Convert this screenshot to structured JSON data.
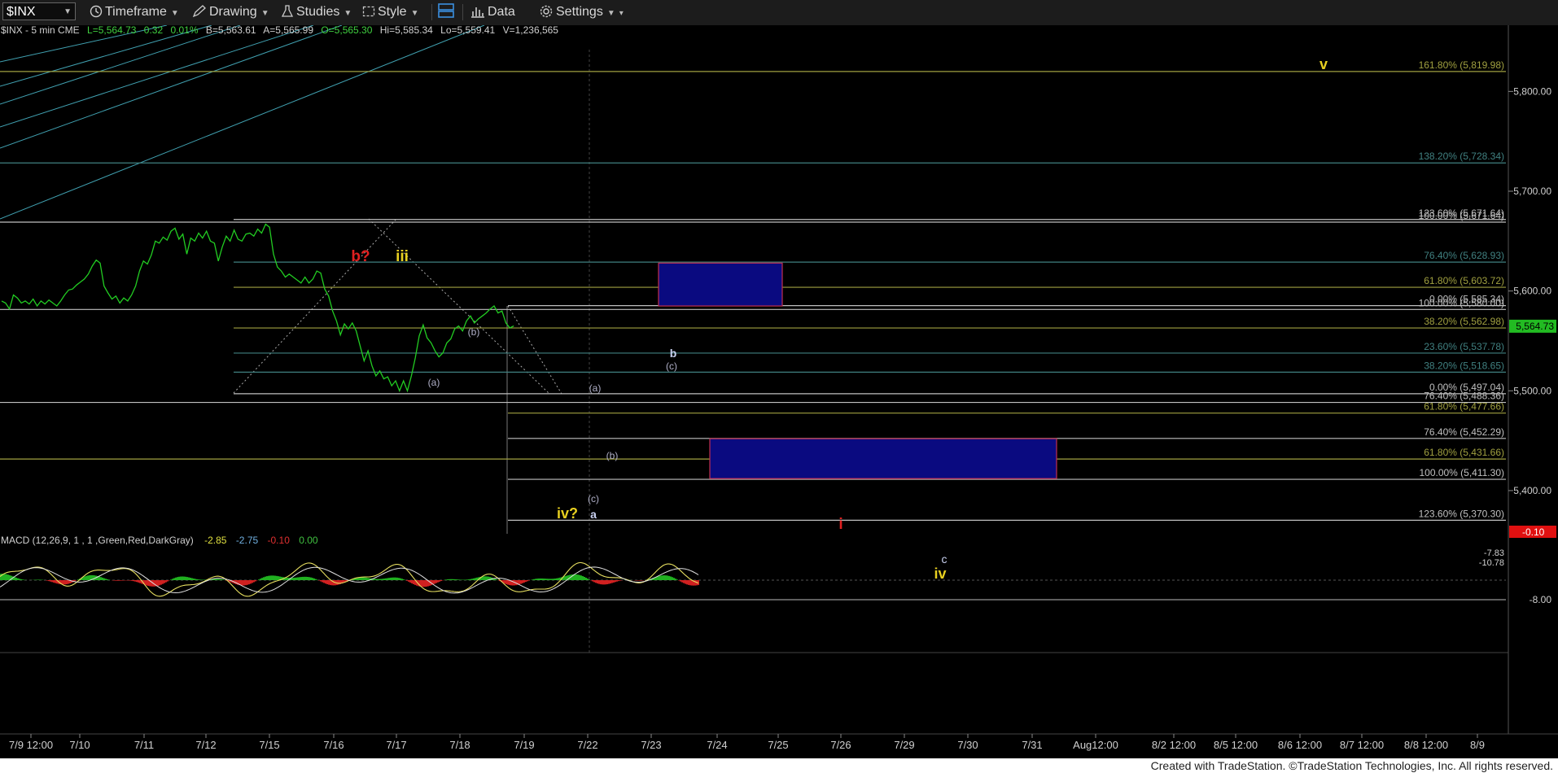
{
  "toolbar": {
    "symbol": "$INX",
    "timeframe": "Timeframe",
    "drawing": "Drawing",
    "studies": "Studies",
    "style": "Style",
    "data": "Data",
    "settings": "Settings"
  },
  "chart_data": {
    "type": "line",
    "info_line": "$INX - 5 min  CME",
    "quote": {
      "last": "L=5,564.73",
      "change": "0.32",
      "change_pct": "0.01%",
      "bid": "B=5,563.61",
      "ask": "A=5,565.99",
      "open": "O=5,565.30",
      "high": "Hi=5,585.34",
      "low": "Lo=5,559.41",
      "volume": "V=1,236,565"
    },
    "price_axis": {
      "ticks": [
        {
          "value": 5800,
          "label": "5,800.00"
        },
        {
          "value": 5700,
          "label": "5,700.00"
        },
        {
          "value": 5600,
          "label": "5,600.00"
        },
        {
          "value": 5500,
          "label": "5,500.00"
        },
        {
          "value": 5400,
          "label": "5,400.00"
        }
      ],
      "last_label": "5,564.73",
      "last_value": 5564.73
    },
    "x_labels": [
      "7/9 12:00",
      "7/10",
      "7/11",
      "7/12",
      "7/15",
      "7/16",
      "7/17",
      "7/18",
      "7/19",
      "7/22",
      "7/23",
      "7/24",
      "7/25",
      "7/26",
      "7/29",
      "7/30",
      "7/31",
      "Aug12:00",
      "8/2 12:00",
      "8/5 12:00",
      "8/6 12:00",
      "8/7 12:00",
      "8/8 12:00",
      "8/9"
    ],
    "series": [
      {
        "name": "$INX",
        "color": "#22cc22",
        "points": [
          [
            0,
            5590
          ],
          [
            4,
            5588
          ],
          [
            8,
            5582
          ],
          [
            12,
            5596
          ],
          [
            16,
            5593
          ],
          [
            20,
            5588
          ],
          [
            24,
            5590
          ],
          [
            28,
            5587
          ],
          [
            32,
            5592
          ],
          [
            36,
            5585
          ],
          [
            40,
            5590
          ],
          [
            44,
            5587
          ],
          [
            48,
            5591
          ],
          [
            52,
            5588
          ],
          [
            56,
            5585
          ],
          [
            60,
            5590
          ],
          [
            64,
            5596
          ],
          [
            68,
            5601
          ],
          [
            72,
            5602
          ],
          [
            76,
            5606
          ],
          [
            80,
            5609
          ],
          [
            84,
            5612
          ],
          [
            88,
            5617
          ],
          [
            92,
            5625
          ],
          [
            96,
            5631
          ],
          [
            100,
            5628
          ],
          [
            104,
            5605
          ],
          [
            108,
            5598
          ],
          [
            112,
            5592
          ],
          [
            116,
            5595
          ],
          [
            120,
            5588
          ],
          [
            124,
            5593
          ],
          [
            128,
            5590
          ],
          [
            132,
            5596
          ],
          [
            136,
            5605
          ],
          [
            140,
            5620
          ],
          [
            144,
            5630
          ],
          [
            148,
            5627
          ],
          [
            152,
            5636
          ],
          [
            156,
            5650
          ],
          [
            160,
            5648
          ],
          [
            164,
            5654
          ],
          [
            168,
            5651
          ],
          [
            172,
            5660
          ],
          [
            176,
            5663
          ],
          [
            180,
            5652
          ],
          [
            184,
            5657
          ],
          [
            188,
            5637
          ],
          [
            192,
            5653
          ],
          [
            196,
            5650
          ],
          [
            200,
            5658
          ],
          [
            204,
            5653
          ],
          [
            208,
            5660
          ],
          [
            212,
            5650
          ],
          [
            216,
            5648
          ],
          [
            220,
            5630
          ],
          [
            224,
            5644
          ],
          [
            228,
            5655
          ],
          [
            232,
            5650
          ],
          [
            236,
            5661
          ],
          [
            240,
            5652
          ],
          [
            244,
            5650
          ],
          [
            248,
            5657
          ],
          [
            252,
            5658
          ],
          [
            256,
            5655
          ],
          [
            260,
            5662
          ],
          [
            264,
            5658
          ],
          [
            268,
            5667
          ],
          [
            272,
            5664
          ],
          [
            276,
            5637
          ],
          [
            280,
            5624
          ],
          [
            284,
            5620
          ],
          [
            288,
            5614
          ],
          [
            292,
            5617
          ],
          [
            296,
            5614
          ],
          [
            300,
            5611
          ],
          [
            304,
            5608
          ],
          [
            308,
            5614
          ],
          [
            312,
            5608
          ],
          [
            316,
            5612
          ],
          [
            320,
            5620
          ],
          [
            324,
            5618
          ],
          [
            328,
            5602
          ],
          [
            332,
            5595
          ],
          [
            336,
            5580
          ],
          [
            340,
            5570
          ],
          [
            344,
            5556
          ],
          [
            348,
            5567
          ],
          [
            352,
            5562
          ],
          [
            356,
            5568
          ],
          [
            360,
            5560
          ],
          [
            364,
            5545
          ],
          [
            368,
            5530
          ],
          [
            372,
            5540
          ],
          [
            376,
            5525
          ],
          [
            380,
            5515
          ],
          [
            384,
            5520
          ],
          [
            388,
            5512
          ],
          [
            392,
            5514
          ],
          [
            396,
            5505
          ],
          [
            400,
            5510
          ],
          [
            404,
            5500
          ],
          [
            408,
            5510
          ],
          [
            412,
            5500
          ],
          [
            416,
            5515
          ],
          [
            420,
            5533
          ],
          [
            424,
            5555
          ],
          [
            428,
            5566
          ],
          [
            432,
            5553
          ],
          [
            436,
            5548
          ],
          [
            440,
            5540
          ],
          [
            444,
            5534
          ],
          [
            448,
            5538
          ],
          [
            452,
            5548
          ],
          [
            456,
            5552
          ],
          [
            460,
            5562
          ],
          [
            464,
            5565
          ],
          [
            468,
            5560
          ],
          [
            472,
            5570
          ],
          [
            476,
            5575
          ],
          [
            480,
            5568
          ],
          [
            484,
            5572
          ],
          [
            488,
            5575
          ],
          [
            492,
            5578
          ],
          [
            496,
            5582
          ],
          [
            500,
            5585
          ],
          [
            504,
            5578
          ],
          [
            508,
            5580
          ],
          [
            512,
            5568
          ],
          [
            516,
            5563
          ],
          [
            520,
            5565
          ]
        ]
      }
    ],
    "fib_levels": [
      {
        "label": "161.80% (5,819.98)",
        "value": 5819.98,
        "color": "#a0a040"
      },
      {
        "label": "138.20% (5,728.34)",
        "value": 5728.34,
        "color": "#408080"
      },
      {
        "label": "123.60% (5,671.64)",
        "value": 5671.64,
        "color": "#c0c0c0"
      },
      {
        "label": "100.00% (5,671.64)",
        "value": 5669.0,
        "color": "#c0c0c0"
      },
      {
        "label": "76.40% (5,628.93)",
        "value": 5628.93,
        "color": "#408080"
      },
      {
        "label": "61.80% (5,603.72)",
        "value": 5603.72,
        "color": "#a0a040"
      },
      {
        "label": "0.00% (5,585.34)",
        "value": 5585.34,
        "color": "#c0c0c0"
      },
      {
        "label": "100.00% (5,580.00)",
        "value": 5581.5,
        "color": "#c0c0c0"
      },
      {
        "label": "38.20% (5,562.98)",
        "value": 5562.98,
        "color": "#a0a040"
      },
      {
        "label": "23.60% (5,537.78)",
        "value": 5537.78,
        "color": "#408080"
      },
      {
        "label": "38.20% (5,518.65)",
        "value": 5518.65,
        "color": "#408080"
      },
      {
        "label": "0.00% (5,497.04)",
        "value": 5497.04,
        "color": "#c0c0c0"
      },
      {
        "label": "76.40% (5,488.36)",
        "value": 5488.36,
        "color": "#c0c0c0"
      },
      {
        "label": "61.80% (5,477.66)",
        "value": 5477.66,
        "color": "#a0a040"
      },
      {
        "label": "76.40% (5,452.29)",
        "value": 5452.29,
        "color": "#c0c0c0"
      },
      {
        "label": "61.80% (5,431.66)",
        "value": 5431.66,
        "color": "#a0a040"
      },
      {
        "label": "100.00% (5,411.30)",
        "value": 5411.3,
        "color": "#c0c0c0"
      },
      {
        "label": "123.60% (5,370.30)",
        "value": 5370.3,
        "color": "#c0c0c0"
      }
    ],
    "target_boxes": [
      {
        "label": "b-target-box",
        "from": 5628,
        "to": 5585
      },
      {
        "label": "iv-target-box",
        "from": 5452,
        "to": 5412
      }
    ],
    "wave_labels": [
      {
        "text": "b?",
        "color": "#e02020"
      },
      {
        "text": "iii",
        "color": "#e8d020"
      },
      {
        "text": "(b)",
        "color": "#b0b0c8"
      },
      {
        "text": "(a)",
        "color": "#b0b0c8"
      },
      {
        "text": "(a)",
        "color": "#b0b0c8"
      },
      {
        "text": "b",
        "color": "#c8d0f0"
      },
      {
        "text": "(c)",
        "color": "#b0b0c8"
      },
      {
        "text": "(b)",
        "color": "#b0b0c8"
      },
      {
        "text": "(c)",
        "color": "#b0b0c8"
      },
      {
        "text": "iv?",
        "color": "#e8d020"
      },
      {
        "text": "a",
        "color": "#c8d0f0"
      },
      {
        "text": "i",
        "color": "#e02020"
      },
      {
        "text": "c",
        "color": "#c8d0f0"
      },
      {
        "text": "iv",
        "color": "#e8d020"
      },
      {
        "text": "v",
        "color": "#e8d020"
      }
    ],
    "macd": {
      "title": "MACD (12,26,9, 1 , 1 ,Green,Red,DarkGray)",
      "v1": "-2.85",
      "v2": "-2.75",
      "v3": "-0.10",
      "v4": "0.00",
      "axis": [
        {
          "value": -8.0,
          "label": "-8.00"
        }
      ],
      "readouts": [
        "-7.83",
        "-10.78"
      ],
      "current_tag": "-0.10"
    }
  },
  "footer": {
    "text": "Created with TradeStation. ©TradeStation Technologies, Inc. All rights reserved."
  }
}
